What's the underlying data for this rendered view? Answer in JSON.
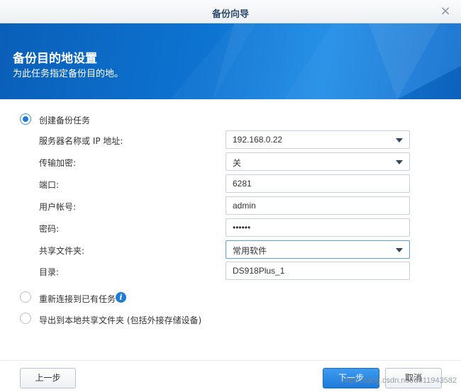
{
  "window": {
    "title": "备份向导",
    "close_icon": "×"
  },
  "banner": {
    "heading": "备份目的地设置",
    "subheading": "为此任务指定备份目的地。"
  },
  "options": {
    "create_task": "创建备份任务",
    "reconnect_task": "重新连接到已有任务",
    "export_local": "导出到本地共享文件夹 (包括外接存储设备)",
    "info_icon_glyph": "i"
  },
  "form": {
    "server_label": "服务器名称或 IP 地址:",
    "server_value": "192.168.0.22",
    "encryption_label": "传输加密:",
    "encryption_value": "关",
    "port_label": "端口:",
    "port_value": "6281",
    "username_label": "用户帐号:",
    "username_value": "admin",
    "password_label": "密码:",
    "password_value": "••••••",
    "shared_folder_label": "共享文件夹:",
    "shared_folder_value": "常用软件",
    "directory_label": "目录:",
    "directory_value": "DS918Plus_1"
  },
  "footer": {
    "back": "上一步",
    "next": "下一步",
    "cancel": "取消"
  },
  "watermark": "https://blog.csdn.net/u011943582",
  "colors": {
    "accent": "#1f7ad8",
    "banner": "#0d74d2"
  }
}
